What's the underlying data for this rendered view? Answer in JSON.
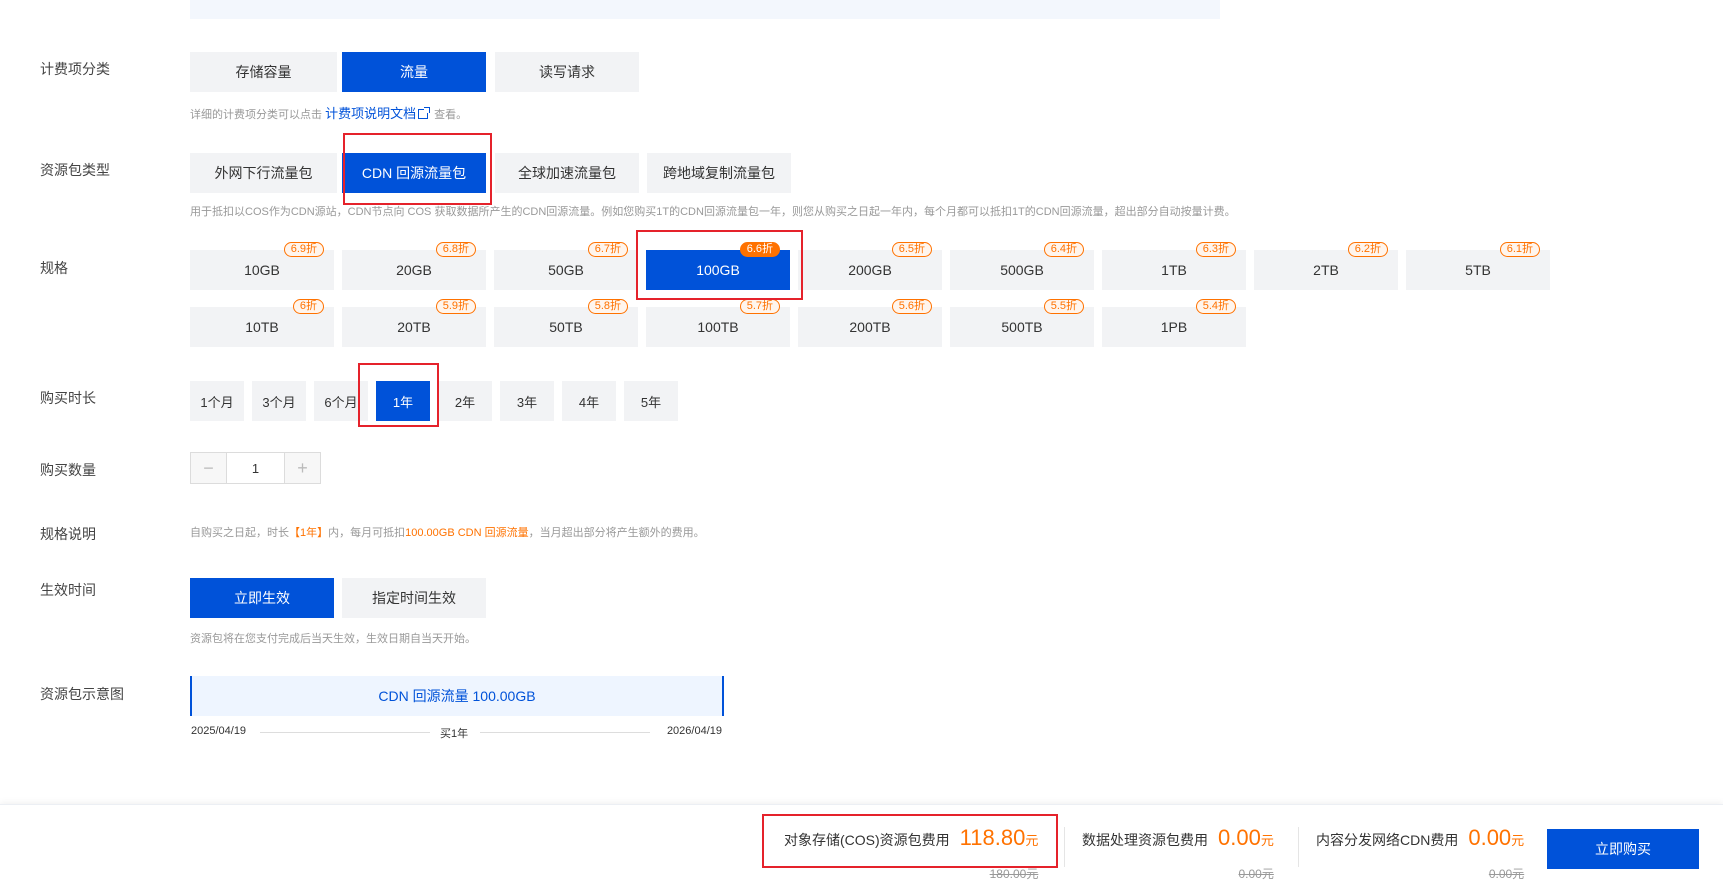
{
  "billing_category": {
    "label": "计费项分类",
    "options": [
      "存储容量",
      "流量",
      "读写请求"
    ],
    "selected": 1,
    "hint_prefix": "详细的计费项分类可以点击",
    "hint_link": "计费项说明文档",
    "hint_suffix": "查看。"
  },
  "package_type": {
    "label": "资源包类型",
    "options": [
      "外网下行流量包",
      "CDN 回源流量包",
      "全球加速流量包",
      "跨地域复制流量包"
    ],
    "selected": 1,
    "hint": "用于抵扣以COS作为CDN源站，CDN节点向 COS 获取数据所产生的CDN回源流量。例如您购买1T的CDN回源流量包一年，则您从购买之日起一年内，每个月都可以抵扣1T的CDN回源流量，超出部分自动按量计费。"
  },
  "spec": {
    "label": "规格",
    "row1": [
      {
        "size": "10GB",
        "discount": "6.9折"
      },
      {
        "size": "20GB",
        "discount": "6.8折"
      },
      {
        "size": "50GB",
        "discount": "6.7折"
      },
      {
        "size": "100GB",
        "discount": "6.6折"
      },
      {
        "size": "200GB",
        "discount": "6.5折"
      },
      {
        "size": "500GB",
        "discount": "6.4折"
      },
      {
        "size": "1TB",
        "discount": "6.3折"
      },
      {
        "size": "2TB",
        "discount": "6.2折"
      },
      {
        "size": "5TB",
        "discount": "6.1折"
      }
    ],
    "row2": [
      {
        "size": "10TB",
        "discount": "6折"
      },
      {
        "size": "20TB",
        "discount": "5.9折"
      },
      {
        "size": "50TB",
        "discount": "5.8折"
      },
      {
        "size": "100TB",
        "discount": "5.7折"
      },
      {
        "size": "200TB",
        "discount": "5.6折"
      },
      {
        "size": "500TB",
        "discount": "5.5折"
      },
      {
        "size": "1PB",
        "discount": "5.4折"
      }
    ],
    "selected": "100GB"
  },
  "duration": {
    "label": "购买时长",
    "options": [
      "1个月",
      "3个月",
      "6个月",
      "1年",
      "2年",
      "3年",
      "4年",
      "5年"
    ],
    "selected": 3
  },
  "quantity": {
    "label": "购买数量",
    "value": "1",
    "minus": "−",
    "plus": "+"
  },
  "spec_desc": {
    "label": "规格说明",
    "part1": "自购买之日起，时长",
    "duration": "【1年】",
    "part2": "内，每月可抵扣",
    "amount": "100.00GB CDN 回源流量",
    "part3": "，当月超出部分将产生额外的费用。"
  },
  "effective_time": {
    "label": "生效时间",
    "options": [
      "立即生效",
      "指定时间生效"
    ],
    "selected": 0,
    "hint": "资源包将在您支付完成后当天生效，生效日期自当天开始。"
  },
  "diagram": {
    "label": "资源包示意图",
    "box_text": "CDN 回源流量 100.00GB",
    "start_date": "2025/04/19",
    "middle": "买1年",
    "end_date": "2026/04/19"
  },
  "footer": {
    "fees": [
      {
        "label": "对象存储(COS)资源包费用",
        "amount": "118.80",
        "unit": "元",
        "original": "180.00元"
      },
      {
        "label": "数据处理资源包费用",
        "amount": "0.00",
        "unit": "元",
        "original": "0.00元"
      },
      {
        "label": "内容分发网络CDN费用",
        "amount": "0.00",
        "unit": "元",
        "original": "0.00元"
      }
    ],
    "buy_button": "立即购买"
  },
  "colors": {
    "primary": "#0052d9",
    "accent": "#ff7200",
    "highlight_box": "#e5222b"
  }
}
